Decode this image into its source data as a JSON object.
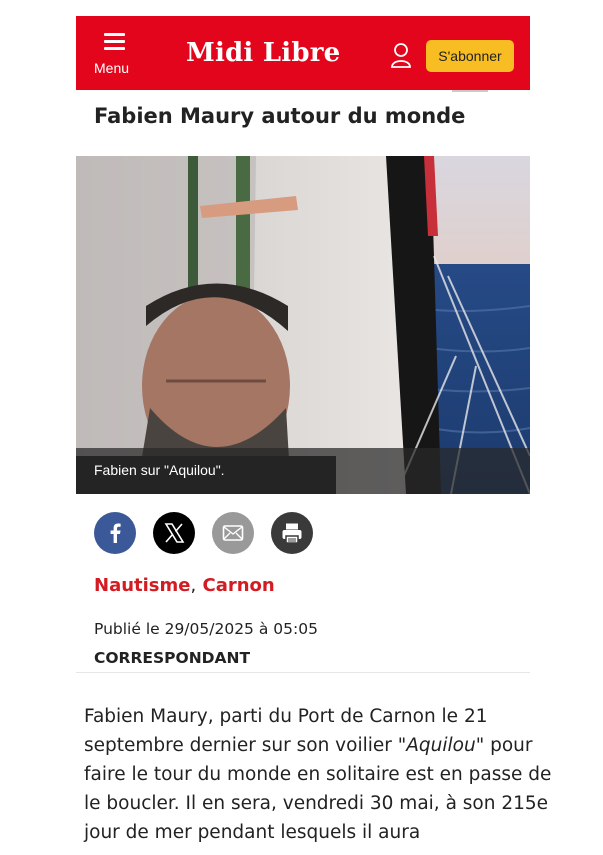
{
  "header": {
    "menu_label": "Menu",
    "logo_text": "Midi Libre",
    "subscribe_label": "S'abonner",
    "brand_color": "#e3051b",
    "accent_color": "#f7bd22",
    "icons": [
      "hamburger-icon",
      "user-icon"
    ]
  },
  "article": {
    "title": "Fabien Maury autour du monde",
    "photo_caption": "Fabien sur \"Aquilou\".",
    "share": [
      {
        "name": "facebook",
        "icon": "facebook-icon",
        "color": "#3b5998"
      },
      {
        "name": "x",
        "icon": "x-icon",
        "color": "#000000"
      },
      {
        "name": "email",
        "icon": "mail-icon",
        "color": "#999999"
      },
      {
        "name": "print",
        "icon": "print-icon",
        "color": "#3a3a3a"
      }
    ],
    "tags": [
      "Nautisme",
      "Carnon"
    ],
    "tag_separator": ",",
    "published": "Publié le 29/05/2025 à 05:05",
    "author": "CORRESPONDANT",
    "body": {
      "part1": "Fabien Maury, parti du Port de Carnon le 21 septembre dernier sur son voilier \"",
      "italic": "Aquilou",
      "part2": "\" pour faire le tour du monde en solitaire est en passe de le boucler. Il en sera, vendredi 30 mai, à son 215e jour de mer pendant lesquels il aura"
    }
  }
}
